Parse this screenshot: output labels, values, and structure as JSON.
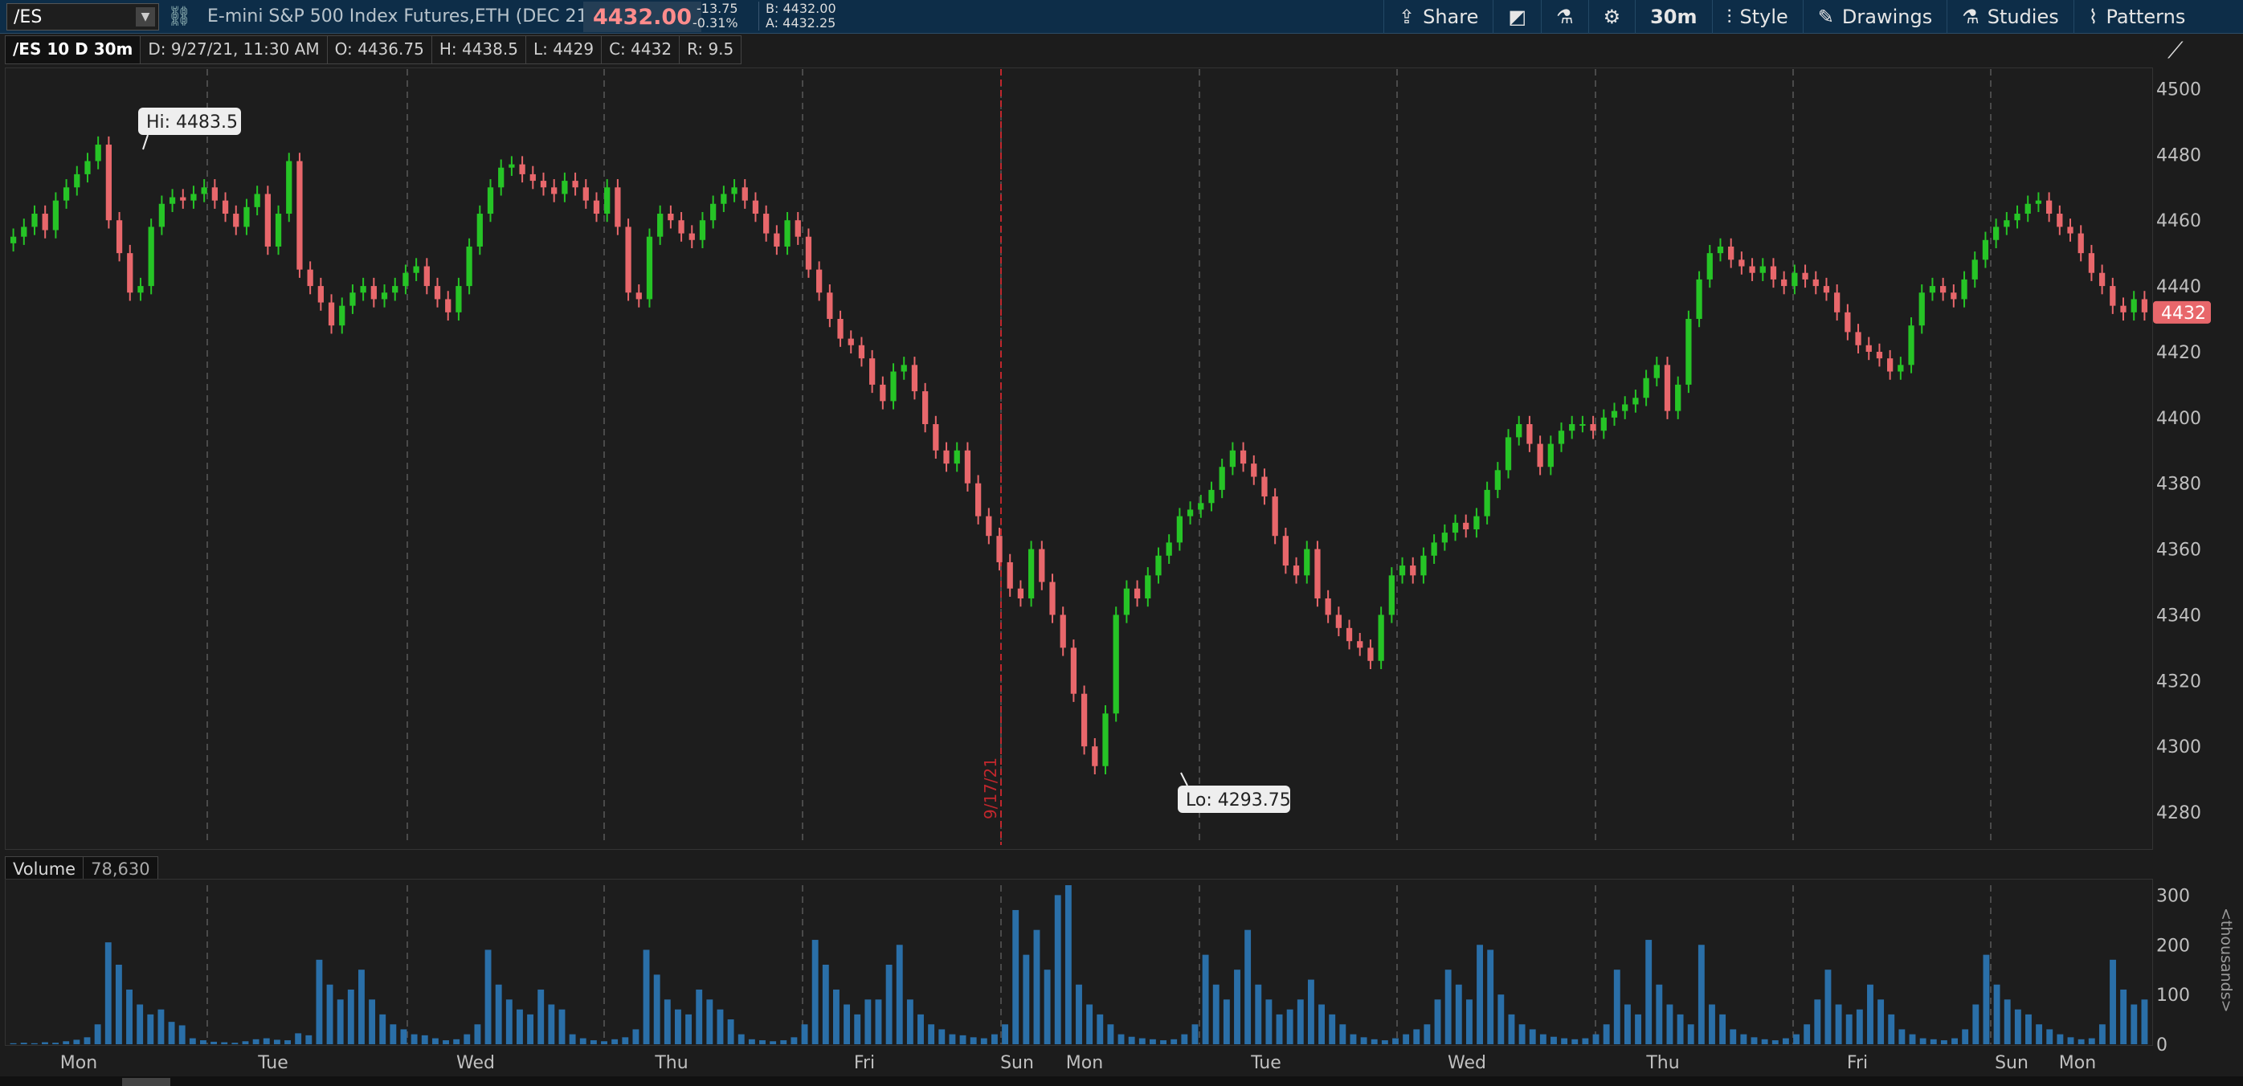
{
  "toolbar": {
    "symbol": "/ES",
    "description": "E-mini S&P 500 Index Futures,ETH (DEC 21)",
    "last_price": "4432.00",
    "change": "-13.75",
    "change_pct": "-0.31%",
    "bid": "B: 4432.00",
    "ask": "A: 4432.25",
    "share_label": "Share",
    "timeframe": "30m",
    "style_label": "Style",
    "drawings_label": "Drawings",
    "studies_label": "Studies",
    "patterns_label": "Patterns",
    "colors": {
      "bg": "#0d2d48",
      "price": "#ff8c8c"
    }
  },
  "info": {
    "title": "/ES 10 D 30m",
    "date": "D: 9/27/21, 11:30 AM",
    "open": "O: 4436.75",
    "high": "H: 4438.5",
    "low": "L: 4429",
    "close": "C: 4432",
    "range": "R: 9.5"
  },
  "volume": {
    "label": "Volume",
    "value": "78,630",
    "unit_label": "<thousands>"
  },
  "chart_data": {
    "type": "candlestick",
    "colors": {
      "up": "#26c426",
      "down": "#e8676b",
      "volume": "#2a6fa8",
      "marker": "#c0272d"
    },
    "hi_label": "Hi: 4483.5",
    "lo_label": "Lo: 4293.75",
    "current_label": "4432",
    "marker_label": "9/17/21",
    "price_ticks": [
      "4500",
      "4480",
      "4460",
      "4440",
      "4420",
      "4400",
      "4380",
      "4360",
      "4340",
      "4320",
      "4300",
      "4280"
    ],
    "volume_ticks": [
      "300",
      "200",
      "100",
      "0"
    ],
    "x_labels": [
      "Mon",
      "Tue",
      "Wed",
      "Thu",
      "Fri",
      "Sun",
      "Mon",
      "Tue",
      "Wed",
      "Thu",
      "Fri",
      "Sun",
      "Mon"
    ],
    "ylim": [
      4270,
      4505
    ],
    "volume_ylim": [
      0,
      320
    ],
    "close_series": [
      4455,
      4458,
      4462,
      4457,
      4466,
      4470,
      4474,
      4478,
      4483,
      4460,
      4450,
      4438,
      4440,
      4458,
      4465,
      4467,
      4466,
      4468,
      4470,
      4466,
      4462,
      4458,
      4464,
      4468,
      4452,
      4462,
      4478,
      4445,
      4440,
      4435,
      4428,
      4434,
      4438,
      4440,
      4436,
      4438,
      4440,
      4444,
      4446,
      4440,
      4436,
      4432,
      4440,
      4452,
      4462,
      4470,
      4476,
      4477,
      4474,
      4472,
      4470,
      4468,
      4472,
      4470,
      4466,
      4462,
      4470,
      4458,
      4438,
      4436,
      4455,
      4462,
      4460,
      4456,
      4454,
      4460,
      4465,
      4468,
      4470,
      4466,
      4462,
      4456,
      4452,
      4460,
      4455,
      4445,
      4438,
      4430,
      4424,
      4422,
      4418,
      4410,
      4405,
      4414,
      4416,
      4408,
      4398,
      4390,
      4386,
      4390,
      4380,
      4370,
      4364,
      4356,
      4348,
      4345,
      4360,
      4350,
      4340,
      4330,
      4316,
      4300,
      4294,
      4310,
      4340,
      4348,
      4345,
      4352,
      4358,
      4362,
      4370,
      4372,
      4374,
      4378,
      4385,
      4390,
      4386,
      4382,
      4376,
      4364,
      4355,
      4352,
      4360,
      4345,
      4340,
      4336,
      4332,
      4330,
      4326,
      4340,
      4352,
      4355,
      4352,
      4358,
      4362,
      4365,
      4368,
      4366,
      4370,
      4378,
      4384,
      4394,
      4398,
      4392,
      4385,
      4392,
      4396,
      4398,
      4398,
      4396,
      4400,
      4402,
      4404,
      4406,
      4412,
      4416,
      4402,
      4410,
      4430,
      4442,
      4450,
      4452,
      4448,
      4446,
      4444,
      4446,
      4442,
      4440,
      4444,
      4442,
      4440,
      4438,
      4432,
      4426,
      4422,
      4420,
      4418,
      4414,
      4416,
      4428,
      4438,
      4440,
      4438,
      4436,
      4442,
      4448,
      4454,
      4458,
      4460,
      4462,
      4465,
      4466,
      4462,
      4458,
      4456,
      4450,
      4444,
      4440,
      4434,
      4432,
      4436,
      4432
    ],
    "volume_series": [
      2,
      3,
      2,
      4,
      3,
      6,
      9,
      14,
      40,
      205,
      160,
      110,
      80,
      60,
      70,
      45,
      38,
      12,
      8,
      5,
      4,
      3,
      6,
      10,
      12,
      9,
      8,
      22,
      18,
      170,
      120,
      90,
      110,
      150,
      90,
      60,
      40,
      30,
      20,
      18,
      12,
      8,
      10,
      20,
      40,
      190,
      120,
      90,
      70,
      60,
      110,
      80,
      70,
      20,
      12,
      8,
      6,
      10,
      14,
      30,
      190,
      140,
      90,
      70,
      60,
      110,
      90,
      70,
      50,
      20,
      10,
      8,
      6,
      8,
      14,
      40,
      210,
      160,
      110,
      80,
      60,
      90,
      90,
      160,
      200,
      90,
      60,
      40,
      30,
      20,
      18,
      14,
      12,
      20,
      40,
      270,
      180,
      230,
      150,
      300,
      320,
      120,
      80,
      60,
      40,
      20,
      15,
      12,
      10,
      8,
      10,
      20,
      40,
      180,
      120,
      90,
      150,
      230,
      120,
      90,
      60,
      70,
      90,
      130,
      80,
      60,
      40,
      20,
      14,
      10,
      8,
      12,
      20,
      30,
      40,
      90,
      150,
      120,
      90,
      200,
      190,
      100,
      60,
      40,
      30,
      20,
      15,
      12,
      10,
      12,
      20,
      40,
      150,
      80,
      60,
      210,
      120,
      80,
      60,
      40,
      200,
      80,
      60,
      30,
      20,
      14,
      10,
      8,
      12,
      20,
      40,
      90,
      150,
      80,
      60,
      70,
      120,
      90,
      60,
      30,
      20,
      12,
      10,
      8,
      12,
      30,
      80,
      180,
      120,
      90,
      70,
      60,
      40,
      30,
      20,
      14,
      10,
      12,
      40,
      170,
      110,
      80,
      90
    ]
  }
}
